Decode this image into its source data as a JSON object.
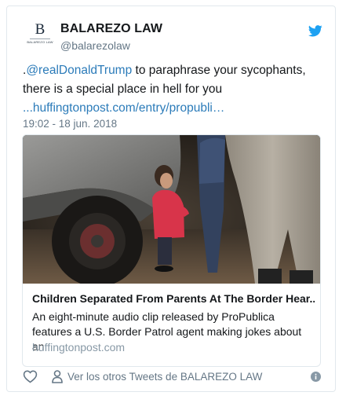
{
  "author": {
    "display_name": "BALAREZO LAW",
    "screen_name": "@balarezolaw",
    "avatar_letter": "B",
    "avatar_text": "BALAREZO LAW"
  },
  "tweet": {
    "mention_prefix": ".",
    "mention": "@realDonaldTrump",
    "text": " to paraphrase your sycophants, there is a special place in hell for you",
    "link": "...huffingtonpost.com/entry/propubli…",
    "timestamp": "19:02 - 18 jun. 2018"
  },
  "card": {
    "title": "Children Separated From Parents At The Border Hear...",
    "description": "An eight-minute audio clip released by ProPublica features a U.S. Border Patrol agent making jokes about an",
    "domain": "huffingtonpost.com"
  },
  "footer": {
    "more_tweets_label": "Ver los otros Tweets de BALAREZO LAW"
  },
  "icons": {
    "brand": "twitter-bird-icon",
    "like": "heart-icon",
    "profile": "person-icon",
    "info": "info-icon"
  },
  "colors": {
    "link": "#2b7bb9",
    "twitter_blue": "#1da1f2",
    "secondary_text": "#657786"
  }
}
